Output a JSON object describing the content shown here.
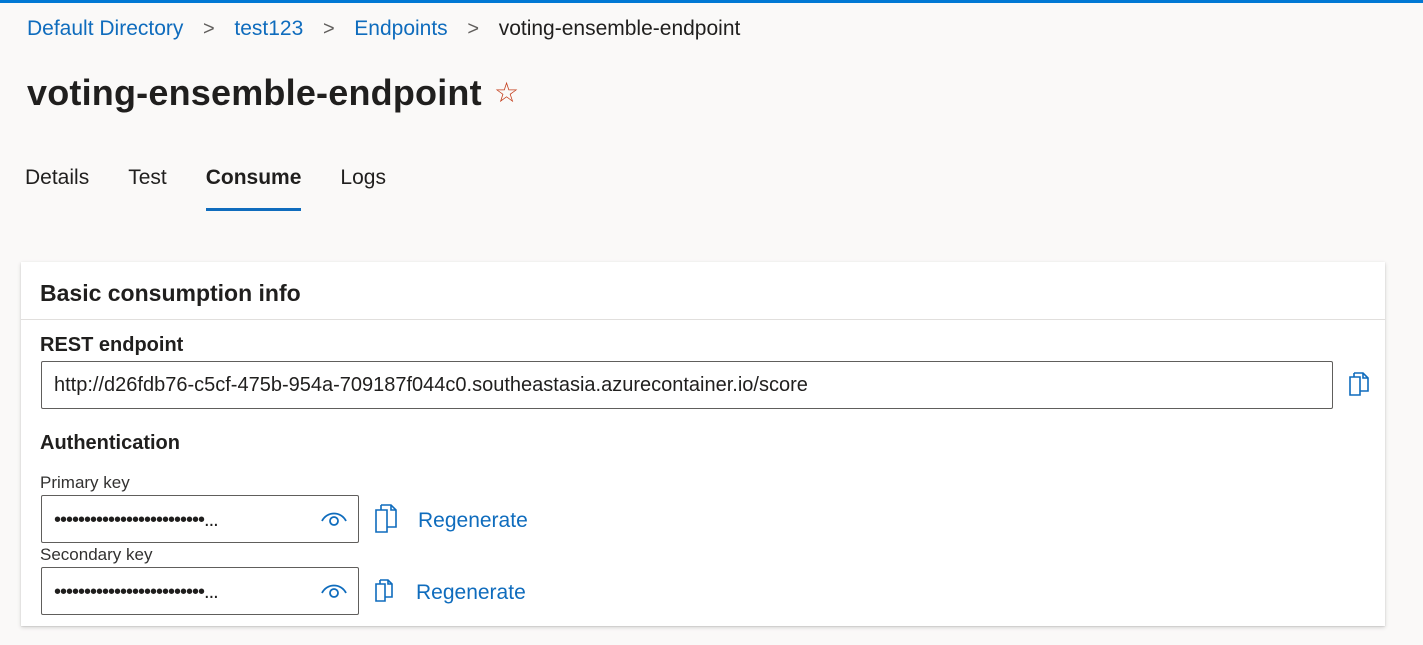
{
  "breadcrumb": {
    "items": [
      "Default Directory",
      "test123",
      "Endpoints"
    ],
    "current": "voting-ensemble-endpoint",
    "separator": ">"
  },
  "header": {
    "title": "voting-ensemble-endpoint",
    "favorite_icon": "star-outline-icon"
  },
  "tabs": [
    {
      "label": "Details",
      "active": false
    },
    {
      "label": "Test",
      "active": false
    },
    {
      "label": "Consume",
      "active": true
    },
    {
      "label": "Logs",
      "active": false
    }
  ],
  "card": {
    "title": "Basic consumption info",
    "rest_endpoint": {
      "label": "REST endpoint",
      "value": "http://d26fdb76-c5cf-475b-954a-709187f044c0.southeastasia.azurecontainer.io/score",
      "copy_icon": "copy-icon"
    },
    "authentication": {
      "label": "Authentication",
      "primary": {
        "label": "Primary key",
        "masked_value": "•••••••••••••••••••••••••...",
        "reveal_icon": "eye-icon",
        "copy_icon": "copy-icon",
        "regenerate_label": "Regenerate"
      },
      "secondary": {
        "label": "Secondary key",
        "masked_value": "•••••••••••••••••••••••••...",
        "reveal_icon": "eye-icon",
        "copy_icon": "copy-icon",
        "regenerate_label": "Regenerate"
      }
    }
  },
  "colors": {
    "accent": "#0f6cbd",
    "top_rule": "#0078d4",
    "star": "#c43e1c",
    "background": "#faf9f8"
  }
}
